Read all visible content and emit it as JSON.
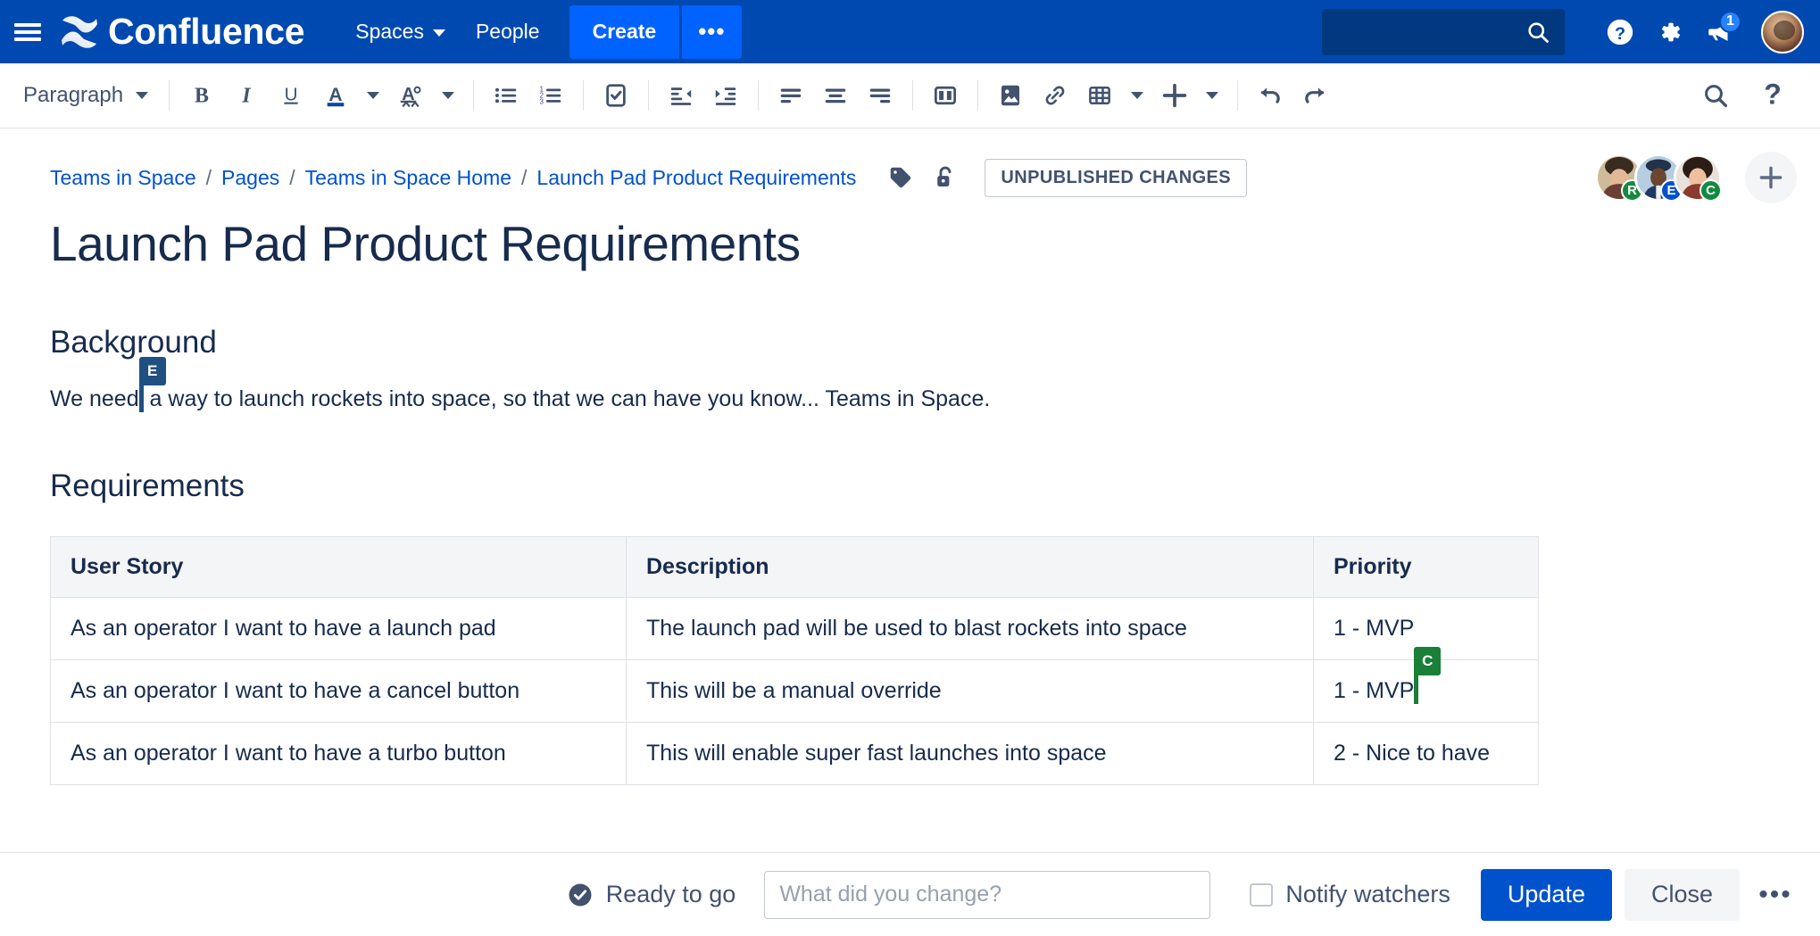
{
  "colors": {
    "nav_bg": "#0049B0",
    "create_bg": "#0062FF",
    "link": "#0052CC",
    "text": "#172B4D",
    "subtle": "#42526E",
    "border": "#DFE1E6",
    "table_header_bg": "#F4F5F7",
    "primary_button": "#0052CC",
    "cursor_blue": "#205081",
    "cursor_green": "#1A7F37",
    "badge_blue": "#2684FF"
  },
  "topnav": {
    "menu_icon": "hamburger-icon",
    "logo_text": "Confluence",
    "logo_icon": "confluence-logo-icon",
    "items": [
      {
        "label": "Spaces",
        "has_chevron": true
      },
      {
        "label": "People",
        "has_chevron": false
      }
    ],
    "create_label": "Create",
    "create_more_label": "•••",
    "search": {
      "placeholder": "",
      "value": "",
      "icon": "search-icon"
    },
    "help_icon": "help-circle-icon",
    "settings_icon": "gear-icon",
    "notifications_icon": "megaphone-icon",
    "notifications_count": "1",
    "profile_icon": "user-avatar"
  },
  "toolbar": {
    "paragraph_label": "Paragraph",
    "buttons": [
      {
        "name": "bold-button",
        "label": "B"
      },
      {
        "name": "italic-button",
        "label": "I"
      },
      {
        "name": "underline-button",
        "label": "U"
      },
      {
        "name": "text-color-button",
        "label": "A"
      },
      {
        "name": "text-style-button",
        "label": "A"
      },
      {
        "name": "bullet-list-button",
        "label": ""
      },
      {
        "name": "numbered-list-button",
        "label": ""
      },
      {
        "name": "task-list-button",
        "label": ""
      },
      {
        "name": "outdent-button",
        "label": ""
      },
      {
        "name": "indent-button",
        "label": ""
      },
      {
        "name": "align-left-button",
        "label": ""
      },
      {
        "name": "align-center-button",
        "label": ""
      },
      {
        "name": "align-right-button",
        "label": ""
      },
      {
        "name": "page-layout-button",
        "label": ""
      },
      {
        "name": "insert-image-button",
        "label": ""
      },
      {
        "name": "insert-link-button",
        "label": ""
      },
      {
        "name": "insert-table-button",
        "label": ""
      },
      {
        "name": "insert-more-button",
        "label": ""
      },
      {
        "name": "undo-button",
        "label": ""
      },
      {
        "name": "redo-button",
        "label": ""
      },
      {
        "name": "find-replace-button",
        "label": ""
      },
      {
        "name": "editor-help-button",
        "label": "?"
      }
    ]
  },
  "breadcrumb": {
    "items": [
      "Teams in Space",
      "Pages",
      "Teams in Space Home",
      "Launch Pad Product Requirements"
    ],
    "separator": "/",
    "labels_icon": "tag-icon",
    "restrictions_icon": "unlock-icon",
    "status_badge": "UNPUBLISHED CHANGES",
    "add_collaborator": "+"
  },
  "collaborators": [
    {
      "initial": "R",
      "badge_color": "#138A3E",
      "skin": "r"
    },
    {
      "initial": "E",
      "badge_color": "#0052CC",
      "skin": "e"
    },
    {
      "initial": "C",
      "badge_color": "#138A3E",
      "skin": "c"
    }
  ],
  "document": {
    "title": "Launch Pad Product Requirements",
    "sections": [
      {
        "heading": "Background",
        "paragraph_before_cursor": "We need",
        "paragraph_after_cursor": " a way to launch rockets into space, so that we can have you know... Teams in Space.",
        "cursor_initial": "E",
        "cursor_color": "#205081"
      },
      {
        "heading": "Requirements"
      }
    ]
  },
  "table": {
    "columns": [
      "User Story",
      "Description",
      "Priority"
    ],
    "rows": [
      {
        "user_story": "As an operator I want to have a launch pad",
        "description": "The launch pad will be used to blast rockets into space",
        "priority": "1 - MVP"
      },
      {
        "user_story": "As an operator I want to have a cancel button",
        "description": "This will be a manual override",
        "priority": "1 - MVP",
        "cursor_initial": "C",
        "cursor_color": "#1A7F37"
      },
      {
        "user_story": "As an operator I want to have a turbo button",
        "description": "This will enable super fast launches into space",
        "priority": "2 - Nice to have"
      }
    ]
  },
  "bottombar": {
    "ready_label": "Ready to go",
    "ready_icon": "check-circle-icon",
    "change_placeholder": "What did you change?",
    "change_value": "",
    "notify_label": "Notify watchers",
    "notify_checked": false,
    "update_label": "Update",
    "close_label": "Close",
    "more_label": "•••"
  }
}
